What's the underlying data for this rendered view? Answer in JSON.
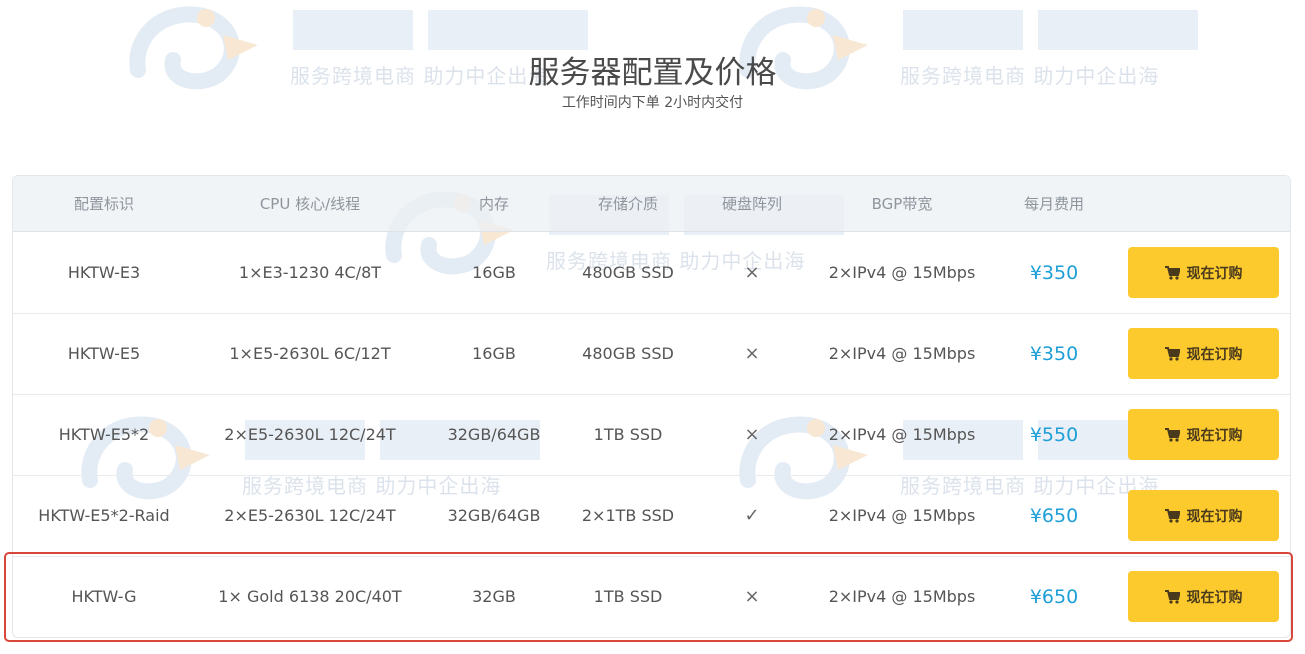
{
  "header": {
    "title": "服务器配置及价格",
    "subtitle": "工作时间内下单 2小时内交付"
  },
  "watermark": {
    "tagline": "服务跨境电商 助力中企出海",
    "color": "#b9c7d8"
  },
  "table": {
    "columns": [
      "配置标识",
      "CPU 核心/线程",
      "内存",
      "存储介质",
      "硬盘阵列",
      "BGP带宽",
      "每月费用",
      ""
    ],
    "order_label": "现在订购",
    "rows": [
      {
        "id": "HKTW-E3",
        "cpu": "1×E3-1230 4C/8T",
        "memory": "16GB",
        "storage": "480GB SSD",
        "raid": "×",
        "bandwidth": "2×IPv4 @ 15Mbps",
        "price": "¥350"
      },
      {
        "id": "HKTW-E5",
        "cpu": "1×E5-2630L 6C/12T",
        "memory": "16GB",
        "storage": "480GB SSD",
        "raid": "×",
        "bandwidth": "2×IPv4 @ 15Mbps",
        "price": "¥350"
      },
      {
        "id": "HKTW-E5*2",
        "cpu": "2×E5-2630L 12C/24T",
        "memory": "32GB/64GB",
        "storage": "1TB SSD",
        "raid": "×",
        "bandwidth": "2×IPv4 @ 15Mbps",
        "price": "¥550"
      },
      {
        "id": "HKTW-E5*2-Raid",
        "cpu": "2×E5-2630L 12C/24T",
        "memory": "32GB/64GB",
        "storage": "2×1TB SSD",
        "raid": "✓",
        "bandwidth": "2×IPv4 @ 15Mbps",
        "price": "¥650"
      },
      {
        "id": "HKTW-G",
        "cpu": "1× Gold 6138 20C/40T",
        "memory": "32GB",
        "storage": "1TB SSD",
        "raid": "×",
        "bandwidth": "2×IPv4 @ 15Mbps",
        "price": "¥650"
      }
    ]
  },
  "colors": {
    "accent_price": "#1e9fd7",
    "button_bg": "#fdca2e",
    "highlight_border": "#d9473b",
    "header_bg": "#ecf0f4"
  },
  "icons": {
    "order": "cart-icon"
  }
}
